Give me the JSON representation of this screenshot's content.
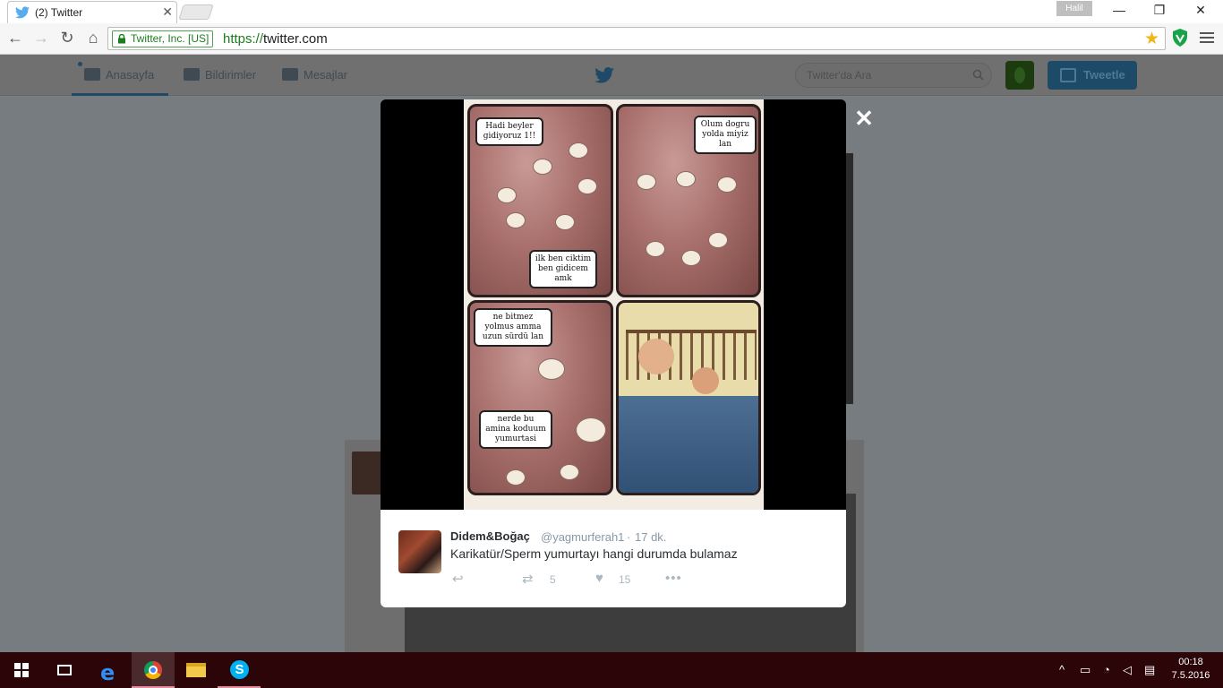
{
  "browser": {
    "tab_title": "(2) Twitter",
    "user_badge": "Halil",
    "ev_label": "Twitter, Inc. [US]",
    "url_scheme": "https://",
    "url_host": "twitter.com"
  },
  "twitter_nav": {
    "home": "Anasayfa",
    "notifications": "Bildirimler",
    "messages": "Mesajlar",
    "search_placeholder": "Twitter'da Ara",
    "tweet_button": "Tweetle"
  },
  "comic": {
    "panel1_bubble1": "Hadi beyler gidiyoruz 1!!",
    "panel1_bubble2": "ilk ben ciktim ben gidicem amk",
    "panel2_bubble": "Olum dogru yolda miyiz lan",
    "panel3_bubble1": "ne bitmez yolmus amma uzun sürdü lan",
    "panel3_bubble2": "nerde bu amina koduum yumurtasi"
  },
  "tweet": {
    "name": "Didem&Boğaç",
    "handle": "@yagmurferah1",
    "separator": "·",
    "time": "17 dk.",
    "text": "Karikatür/Sperm yumurtayı hangi durumda bulamaz",
    "retweets": "5",
    "likes": "15"
  },
  "taskbar": {
    "time": "00:18",
    "date": "7.5.2016"
  }
}
